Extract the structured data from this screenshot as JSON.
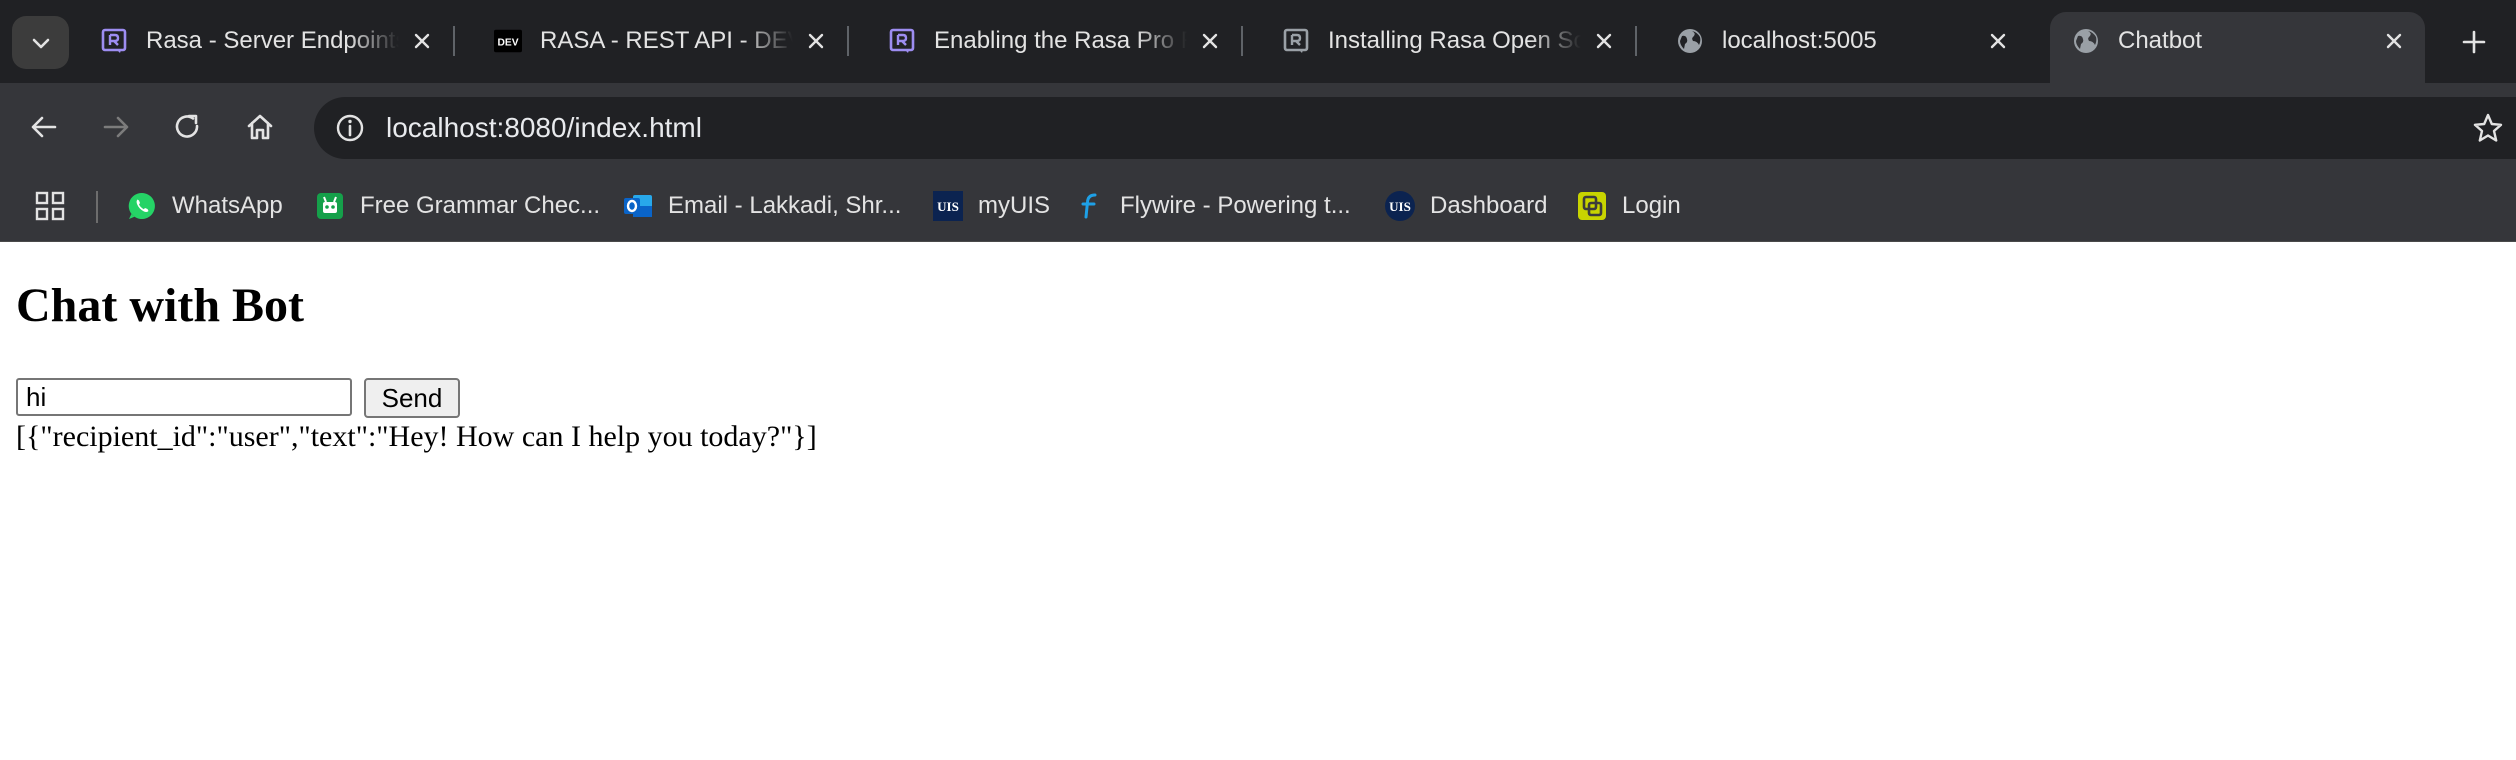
{
  "browser": {
    "tabs": [
      {
        "title": "Rasa - Server Endpoints",
        "icon": "rasa-icon",
        "active": false
      },
      {
        "title": "RASA - REST API - DEV Community",
        "icon": "dev-icon",
        "active": false
      },
      {
        "title": "Enabling the Rasa Pro REST API",
        "icon": "rasa-icon",
        "active": false
      },
      {
        "title": "Installing Rasa Open Source",
        "icon": "rasa-gray-icon",
        "active": false
      },
      {
        "title": "localhost:5005",
        "icon": "globe-icon",
        "active": false
      },
      {
        "title": "Chatbot",
        "icon": "globe-icon",
        "active": true
      }
    ],
    "address": "localhost:8080/index.html",
    "bookmarks": [
      {
        "label": "WhatsApp",
        "icon": "whatsapp-icon"
      },
      {
        "label": "Free Grammar Chec...",
        "icon": "grammar-icon"
      },
      {
        "label": "Email - Lakkadi, Shr...",
        "icon": "outlook-icon"
      },
      {
        "label": "myUIS",
        "icon": "uis-icon"
      },
      {
        "label": "Flywire - Powering t...",
        "icon": "flywire-icon"
      },
      {
        "label": "Dashboard",
        "icon": "uis-icon"
      },
      {
        "label": "Login",
        "icon": "login-icon"
      }
    ],
    "icon_text": {
      "dev": "DEV",
      "uis": "UIS"
    }
  },
  "page": {
    "heading": "Chat with Bot",
    "input_value": "hi",
    "send_label": "Send",
    "response": "[{\"recipient_id\":\"user\",\"text\":\"Hey! How can I help you today?\"}]"
  },
  "colors": {
    "tabstrip_bg": "#202124",
    "toolbar_bg": "#35363a",
    "rasa_purple": "#9d8df1",
    "whatsapp_green": "#25d366",
    "grammar_green": "#15a04a",
    "outlook_blue": "#0a64c8",
    "uis_navy": "#0b2350",
    "flywire_blue": "#1ea0e6",
    "login_yellow": "#c8d400"
  }
}
